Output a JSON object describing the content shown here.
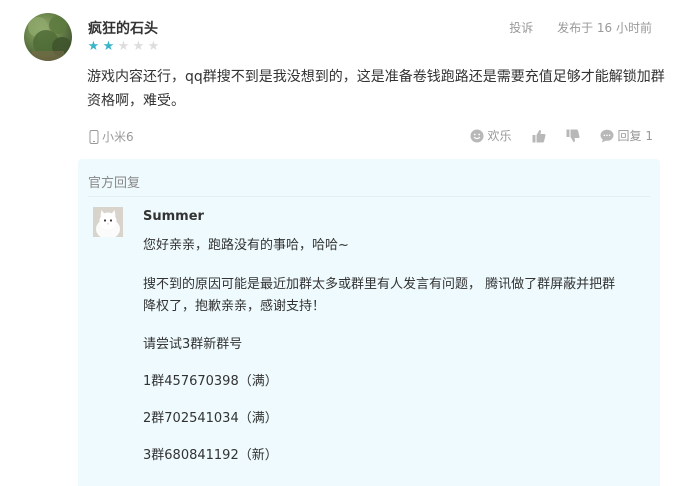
{
  "review": {
    "username": "疯狂的石头",
    "rating": {
      "filled": 2,
      "total": 5
    },
    "report_label": "投诉",
    "timestamp": "发布于 16 小时前",
    "text": "游戏内容还行，qq群搜不到是我没想到的，这是准备卷钱跑路还是需要充值足够才能解锁加群资格啊，难受。",
    "device_icon": "phone-icon",
    "device": "小米6",
    "actions": {
      "funny_label": "欢乐",
      "reply_label": "回复 1"
    }
  },
  "official_reply": {
    "title": "官方回复",
    "author": "Summer",
    "lines": {
      "l1": "您好亲亲，跑路没有的事哈，哈哈~",
      "l2a": "搜不到的原因可能是最近加群太多或群里有人发言有问题， 腾讯做了群屏蔽并把群",
      "l2b": "降权了，抱歉亲亲，感谢支持！",
      "l3": "请尝试3群新群号",
      "l4": "1群457670398（满）",
      "l5": "2群702541034（满）",
      "l6": "3群680841192（新）"
    }
  },
  "colors": {
    "star_filled": "#39b4c8",
    "star_empty": "#dddddd",
    "official_bg": "#eefafd",
    "muted_text": "#999999"
  }
}
